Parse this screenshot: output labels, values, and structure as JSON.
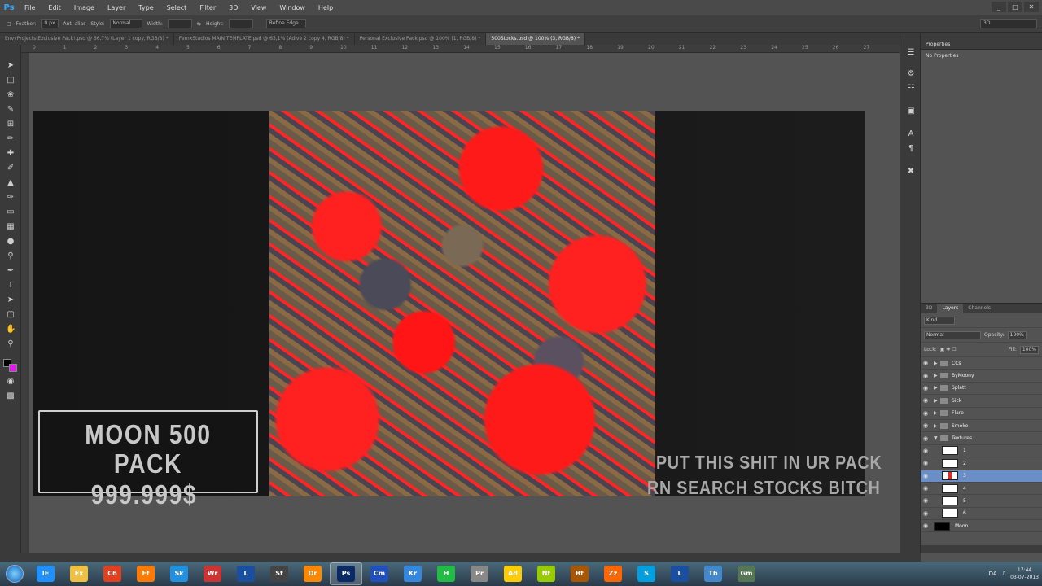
{
  "app": {
    "logo": "Ps"
  },
  "menu": [
    "File",
    "Edit",
    "Image",
    "Layer",
    "Type",
    "Select",
    "Filter",
    "3D",
    "View",
    "Window",
    "Help"
  ],
  "window_controls": [
    "_",
    "□",
    "✕"
  ],
  "options": {
    "feather_label": "Feather:",
    "feather_value": "0 px",
    "antialias": "Anti-alias",
    "style_label": "Style:",
    "style_value": "Normal",
    "width_label": "Width:",
    "height_label": "Height:",
    "refine_edge": "Refine Edge...",
    "workspace": "3D"
  },
  "tabs": [
    "EnvyProjects Exclusive Pack!.psd @ 66,7% (Layer 1 copy, RGB/8) *",
    "FernxStudios MAIN TEMPLATE.psd @ 63,1% (Adive 2 copy 4, RGB/8) *",
    "Personal Exclusive Pack.psd @ 100% (1, RGB/8) *",
    "500Stocks.psd @ 100% (3, RGB/8) *"
  ],
  "ruler_ticks": [
    "0",
    "1",
    "2",
    "3",
    "4",
    "5",
    "6",
    "7",
    "8",
    "9",
    "10",
    "11",
    "12",
    "13",
    "14",
    "15",
    "16",
    "17",
    "18",
    "19",
    "20",
    "21",
    "22",
    "23",
    "24",
    "25",
    "26",
    "27"
  ],
  "canvas": {
    "moon_title": "MOON 500 PACK",
    "moon_price": "999.999$",
    "overlay_line1": "PUT THIS SHIT IN UR PACK",
    "overlay_line2": "RN SEARCH STOCKS BITCH"
  },
  "properties": {
    "title": "Properties",
    "body": "No Properties"
  },
  "layers_panel": {
    "tabs": [
      "3D",
      "Layers",
      "Channels"
    ],
    "kind": "Kind",
    "blend": "Normal",
    "opacity_label": "Opacity:",
    "opacity": "100%",
    "lock_label": "Lock:",
    "fill_label": "Fill:",
    "fill": "100%",
    "layers": [
      {
        "name": "CCs",
        "type": "folder"
      },
      {
        "name": "ByMoony",
        "type": "folder"
      },
      {
        "name": "Splatt",
        "type": "folder"
      },
      {
        "name": "Sick",
        "type": "folder"
      },
      {
        "name": "Flare",
        "type": "folder"
      },
      {
        "name": "Smoke",
        "type": "folder"
      },
      {
        "name": "Textures",
        "type": "folder-open"
      },
      {
        "name": "1",
        "type": "layer"
      },
      {
        "name": "2",
        "type": "layer"
      },
      {
        "name": "3",
        "type": "layer",
        "selected": true
      },
      {
        "name": "4",
        "type": "layer"
      },
      {
        "name": "5",
        "type": "layer"
      },
      {
        "name": "6",
        "type": "layer"
      },
      {
        "name": "Moon",
        "type": "layer-black"
      }
    ]
  },
  "tray": {
    "lang": "DA",
    "time": "17:44",
    "date": "03-07-2013"
  },
  "taskbar_apps": [
    "IE",
    "Ex",
    "Ch",
    "Ff",
    "Sk",
    "Wr",
    "L",
    "St",
    "Or",
    "Ps",
    "Cm",
    "Kr",
    "H",
    "Pr",
    "Ad",
    "Nt",
    "Bt",
    "Zz",
    "S",
    "L",
    "Tb",
    "Gm"
  ]
}
